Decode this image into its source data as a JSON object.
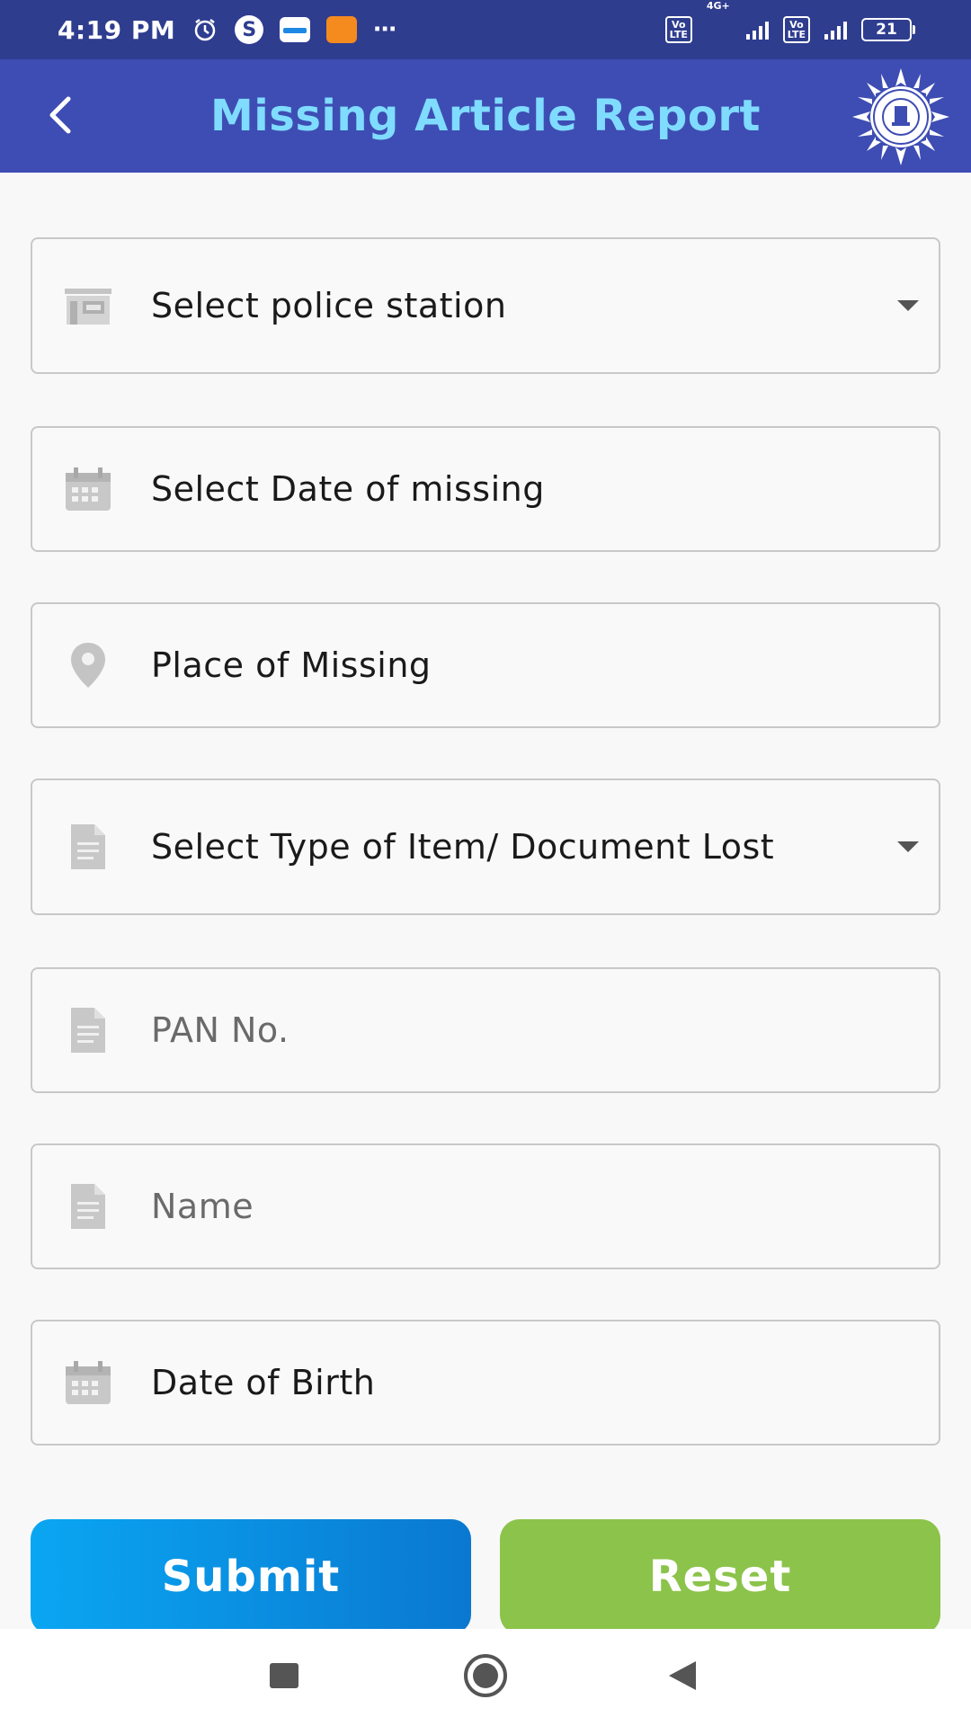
{
  "status_bar": {
    "time": "4:19 PM",
    "network_type": "4G+",
    "volte_1": "Vo LTE",
    "volte_2": "Vo LTE",
    "battery": "21",
    "more": "⋯"
  },
  "header": {
    "title": "Missing Article Report",
    "back_icon": "chevron-left-icon",
    "logo": "police-emblem",
    "background_color": "#3e4db3",
    "title_color": "#7fdcff"
  },
  "form": {
    "police_station": {
      "label": "Select police station",
      "icon": "building-icon"
    },
    "date_of_missing": {
      "label": "Select Date of missing",
      "icon": "calendar-icon"
    },
    "place_of_missing": {
      "label": "Place of Missing",
      "icon": "location-pin-icon"
    },
    "item_type": {
      "label": "Select Type of Item/ Document Lost",
      "icon": "document-icon"
    },
    "pan_no": {
      "placeholder": "PAN No.",
      "icon": "document-icon"
    },
    "name": {
      "placeholder": "Name",
      "icon": "document-icon"
    },
    "date_of_birth": {
      "label": "Date of Birth",
      "icon": "calendar-icon"
    }
  },
  "buttons": {
    "submit": "Submit",
    "reset": "Reset",
    "submit_color": "#0a8fe0",
    "reset_color": "#8cc34b"
  },
  "nav_bar": {
    "recents": "square-icon",
    "home": "circle-icon",
    "back": "triangle-back-icon"
  }
}
